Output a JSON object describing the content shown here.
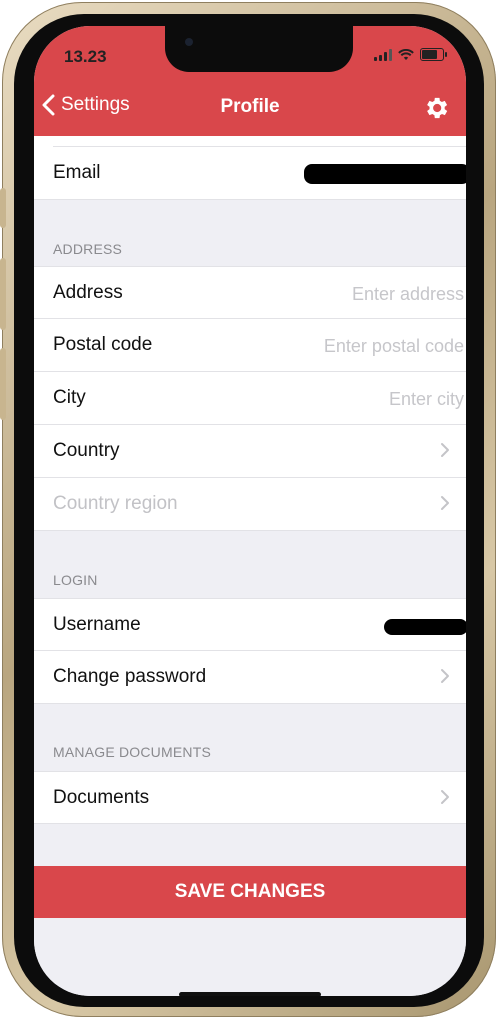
{
  "status_bar": {
    "time": "13.23"
  },
  "nav": {
    "back_label": "Settings",
    "title": "Profile"
  },
  "email_row": {
    "label": "Email"
  },
  "address_section": {
    "header": "ADDRESS",
    "rows": [
      {
        "label": "Address",
        "placeholder": "Enter address"
      },
      {
        "label": "Postal code",
        "placeholder": "Enter postal code"
      },
      {
        "label": "City",
        "placeholder": "Enter city"
      },
      {
        "label": "Country"
      },
      {
        "label": "Country region"
      }
    ]
  },
  "login_section": {
    "header": "LOGIN",
    "rows": [
      {
        "label": "Username"
      },
      {
        "label": "Change password"
      }
    ]
  },
  "documents_section": {
    "header": "MANAGE DOCUMENTS",
    "rows": [
      {
        "label": "Documents"
      }
    ]
  },
  "save_button": {
    "label": "SAVE CHANGES"
  },
  "colors": {
    "accent": "#d9474b",
    "background": "#efeff4",
    "placeholder": "#c6c6ca"
  }
}
